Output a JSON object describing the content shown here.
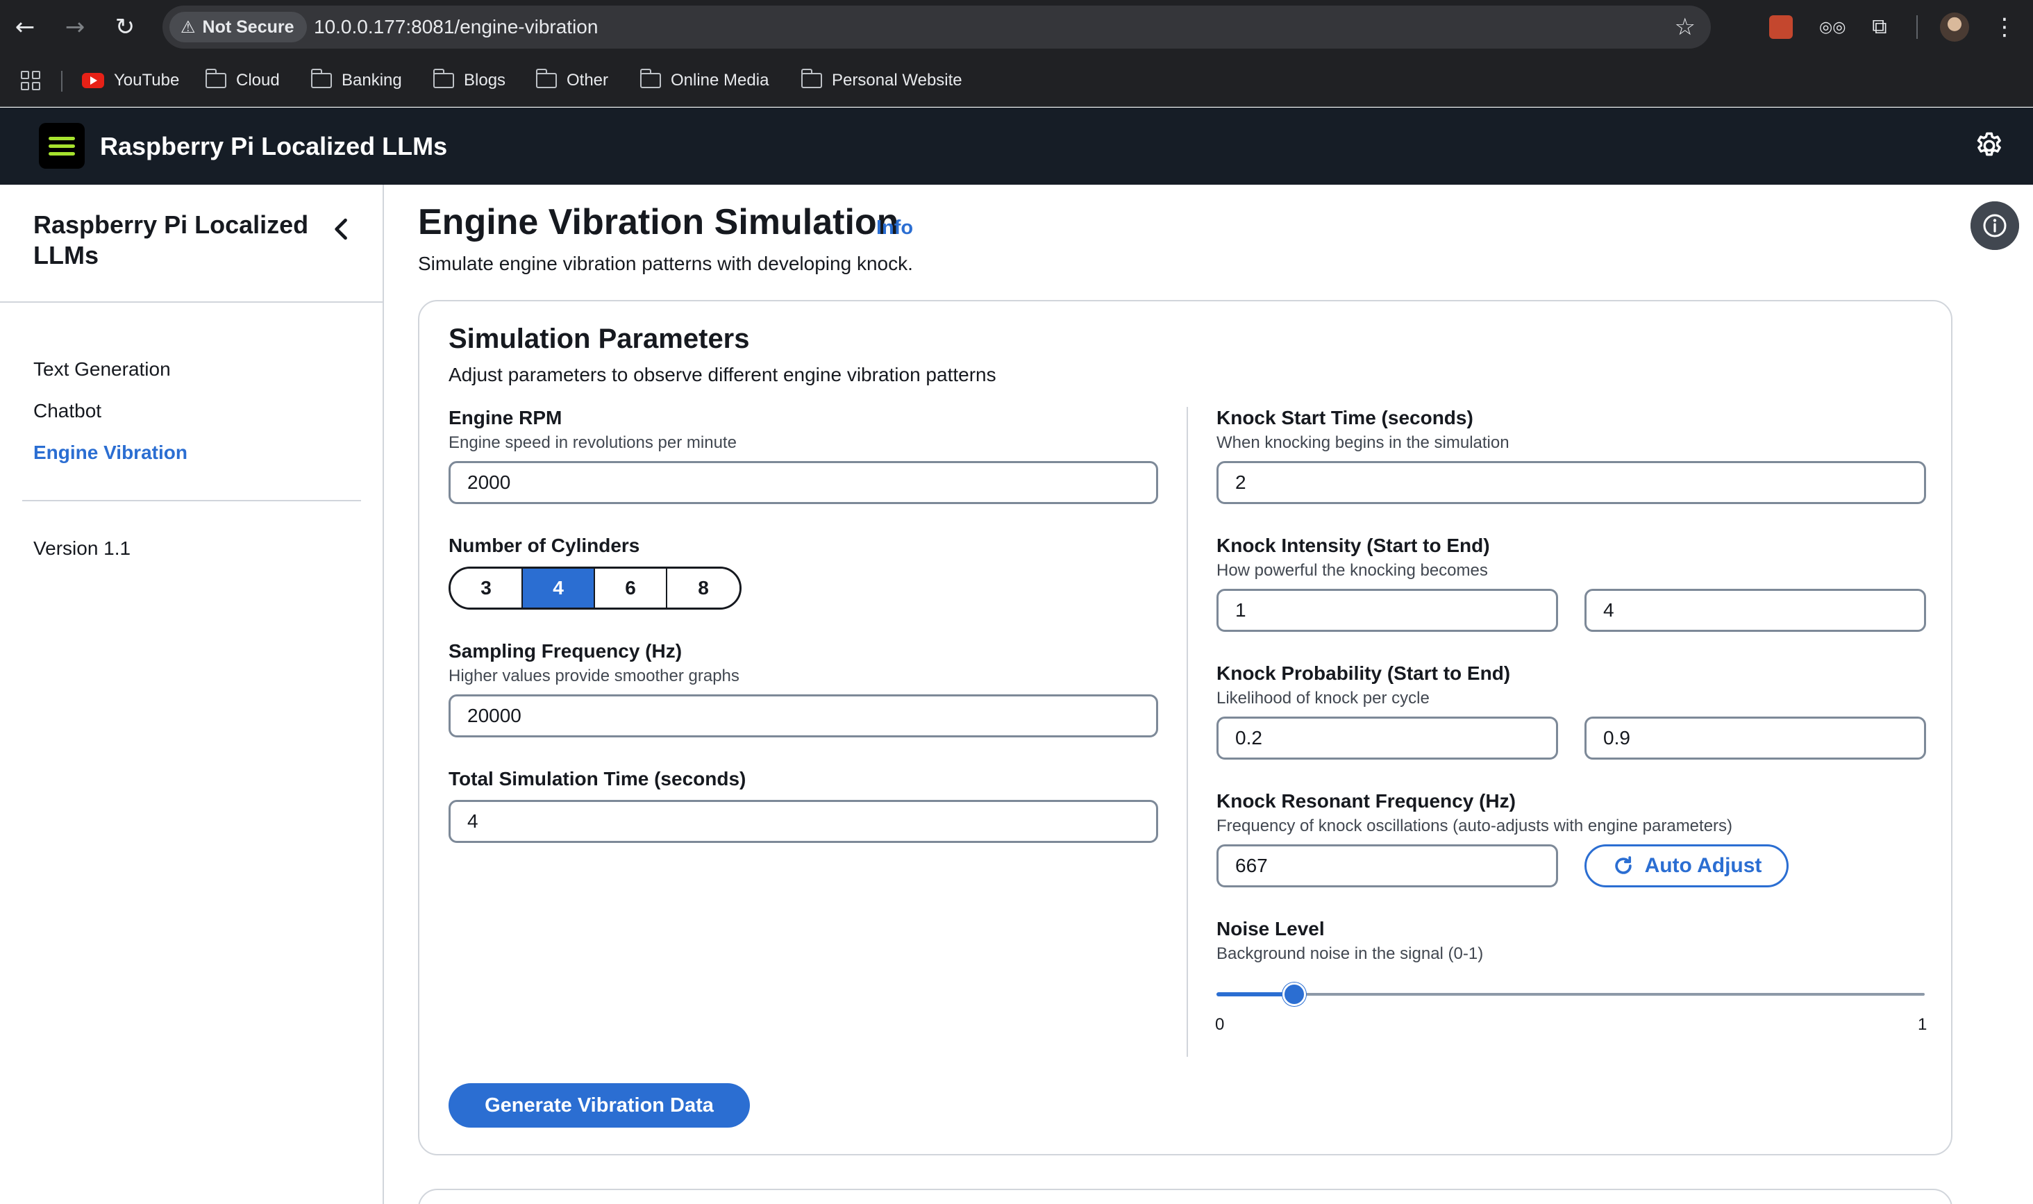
{
  "browser": {
    "security_label": "Not Secure",
    "url": "10.0.0.177:8081/engine-vibration",
    "bookmarks": [
      {
        "label": "YouTube",
        "icon": "youtube-icon"
      },
      {
        "label": "Cloud",
        "icon": "folder-icon"
      },
      {
        "label": "Banking",
        "icon": "folder-icon"
      },
      {
        "label": "Blogs",
        "icon": "folder-icon"
      },
      {
        "label": "Other",
        "icon": "folder-icon"
      },
      {
        "label": "Online Media",
        "icon": "folder-icon"
      },
      {
        "label": "Personal Website",
        "icon": "folder-icon"
      }
    ]
  },
  "header": {
    "title": "Raspberry Pi Localized LLMs"
  },
  "sidebar": {
    "title": "Raspberry Pi Localized LLMs",
    "items": [
      {
        "label": "Text Generation",
        "active": false
      },
      {
        "label": "Chatbot",
        "active": false
      },
      {
        "label": "Engine Vibration",
        "active": true
      }
    ],
    "version": "Version 1.1"
  },
  "page": {
    "title": "Engine Vibration Simulation",
    "info_link": "Info",
    "description": "Simulate engine vibration patterns with developing knock."
  },
  "params": {
    "title": "Simulation Parameters",
    "description": "Adjust parameters to observe different engine vibration patterns",
    "engine_rpm": {
      "label": "Engine RPM",
      "hint": "Engine speed in revolutions per minute",
      "value": "2000"
    },
    "cylinders": {
      "label": "Number of Cylinders",
      "options": [
        "3",
        "4",
        "6",
        "8"
      ],
      "selected": "4"
    },
    "sampling": {
      "label": "Sampling Frequency (Hz)",
      "hint": "Higher values provide smoother graphs",
      "value": "20000"
    },
    "total_time": {
      "label": "Total Simulation Time (seconds)",
      "value": "4"
    },
    "knock_start": {
      "label": "Knock Start Time (seconds)",
      "hint": "When knocking begins in the simulation",
      "value": "2"
    },
    "knock_intensity": {
      "label": "Knock Intensity (Start to End)",
      "hint": "How powerful the knocking becomes",
      "start": "1",
      "end": "4"
    },
    "knock_probability": {
      "label": "Knock Probability (Start to End)",
      "hint": "Likelihood of knock per cycle",
      "start": "0.2",
      "end": "0.9"
    },
    "resonant_freq": {
      "label": "Knock Resonant Frequency (Hz)",
      "hint": "Frequency of knock oscillations (auto-adjusts with engine parameters)",
      "value": "667",
      "auto_adjust_label": "Auto Adjust"
    },
    "noise": {
      "label": "Noise Level",
      "hint": "Background noise in the signal (0-1)",
      "value": 0.11,
      "min_label": "0",
      "max_label": "1"
    },
    "generate_label": "Generate Vibration Data"
  },
  "colors": {
    "accent": "#2b6ed2",
    "header_bg": "#161d26",
    "hamburger_accent": "#a6e22e"
  }
}
